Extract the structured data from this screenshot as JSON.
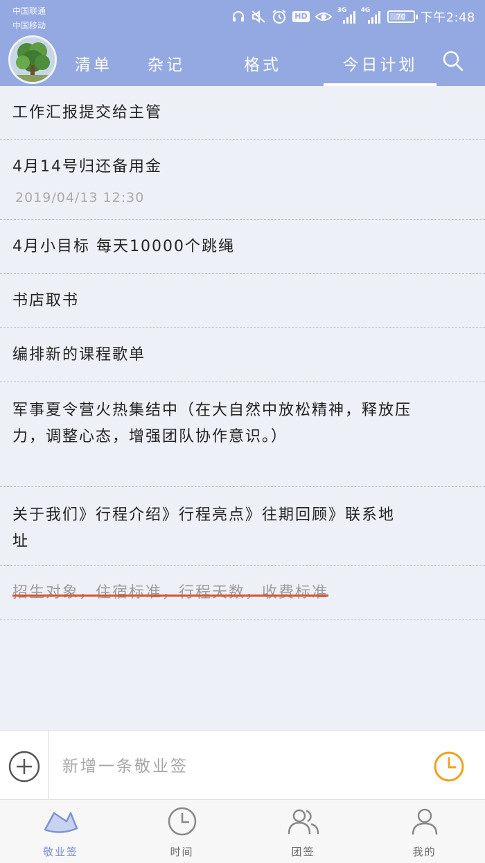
{
  "status_bar": {
    "carrier_1": "中国联通",
    "carrier_2": "中国移动",
    "net_3g": "3G",
    "net_4g": "4G",
    "hd": "HD",
    "battery": "70",
    "battery_level": 0.7,
    "time": "下午2:48"
  },
  "header": {
    "tabs": [
      {
        "label": "清单"
      },
      {
        "label": "杂记"
      },
      {
        "label": "格式"
      },
      {
        "label": "今日计划"
      }
    ],
    "active_tab": "今日计划"
  },
  "list": {
    "items": [
      {
        "text": "工作汇报提交给主管"
      },
      {
        "text": "4月14号归还备用金",
        "date": "2019/04/13  12:30"
      },
      {
        "text": "4月小目标  每天10000个跳绳"
      },
      {
        "text": "书店取书"
      },
      {
        "text": "编排新的课程歌单"
      },
      {
        "text": "军事夏令营火热集结中（在大自然中放松精神，释放压力，调整心态，增强团队协作意识。）"
      },
      {
        "text": "关于我们》行程介绍》行程亮点》往期回顾》联系地址"
      },
      {
        "text": "招生对象，住宿标准，行程天数，收费标准",
        "completed": true
      }
    ]
  },
  "input_bar": {
    "placeholder": "新增一条敬业签"
  },
  "bottom_nav": {
    "items": [
      {
        "label": "敬业签"
      },
      {
        "label": "时间"
      },
      {
        "label": "团签"
      },
      {
        "label": "我的"
      }
    ],
    "active": "敬业签"
  },
  "colors": {
    "header": "#94a9e2",
    "accent": "#7d92d6",
    "strike": "#d9532e",
    "clock": "#f0a020"
  }
}
